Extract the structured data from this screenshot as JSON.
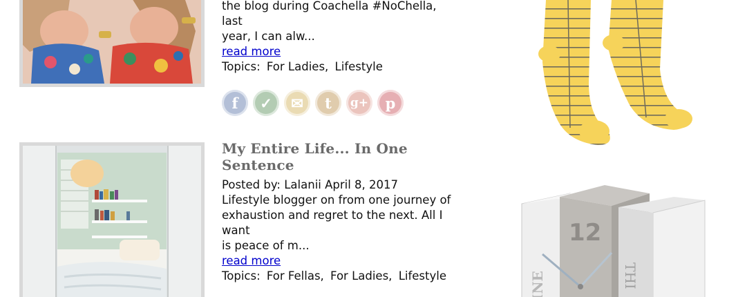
{
  "posts": [
    {
      "excerpt_lines": [
        "the blog during Coachella #NoChella, last",
        "year, I can alw..."
      ],
      "read_more": "read more",
      "topics_label": "Topics:",
      "topics": [
        "For Ladies,",
        "Lifestyle"
      ]
    },
    {
      "title_lines": [
        "My Entire Life... In One",
        "Sentence"
      ],
      "posted_by": "Posted by: Lalanii April 8, 2017",
      "excerpt_lines": [
        "Lifestyle blogger on from one journey of",
        "exhaustion and regret to the next. All I want",
        "is peace of m..."
      ],
      "read_more": "read more",
      "topics_label": "Topics:",
      "topics": [
        "For Fellas,",
        "For Ladies,",
        "Lifestyle"
      ]
    }
  ],
  "share_icons": [
    {
      "name": "facebook-icon",
      "glyph": "f",
      "color": "#3b5998"
    },
    {
      "name": "twitter-icon",
      "glyph": "✓",
      "color": "#3a7a3a"
    },
    {
      "name": "email-icon",
      "glyph": "✉",
      "color": "#c9a23a"
    },
    {
      "name": "tumblr-icon",
      "glyph": "t",
      "color": "#b07a2a"
    },
    {
      "name": "google-plus-icon",
      "glyph": "g+",
      "color": "#cc6655"
    },
    {
      "name": "pinterest-icon",
      "glyph": "p",
      "color": "#c0303a"
    }
  ],
  "clock_number": "12",
  "colors": {
    "link": "#0000cc",
    "title": "#6a6a6a",
    "thumb_border": "#d9d9d9",
    "sock_yellow": "#f6d35a"
  }
}
